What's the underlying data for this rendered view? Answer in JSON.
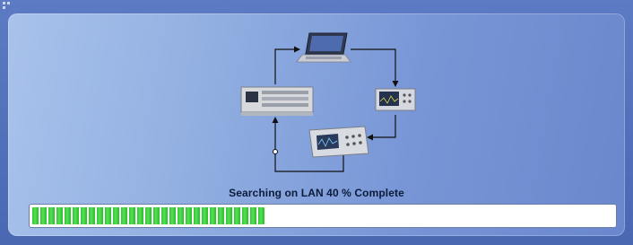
{
  "status": {
    "message": "Searching on LAN 40 % Complete"
  },
  "progress": {
    "percent": 40,
    "color": "#32c232"
  },
  "diagram": {
    "devices": [
      "laptop-icon",
      "oscilloscope-icon",
      "oscilloscope-icon",
      "oscilloscope-icon"
    ]
  },
  "colors": {
    "panel_light": "#a8c2eb",
    "panel_dark": "#6a87cd",
    "frame": "#4f6fb9"
  }
}
